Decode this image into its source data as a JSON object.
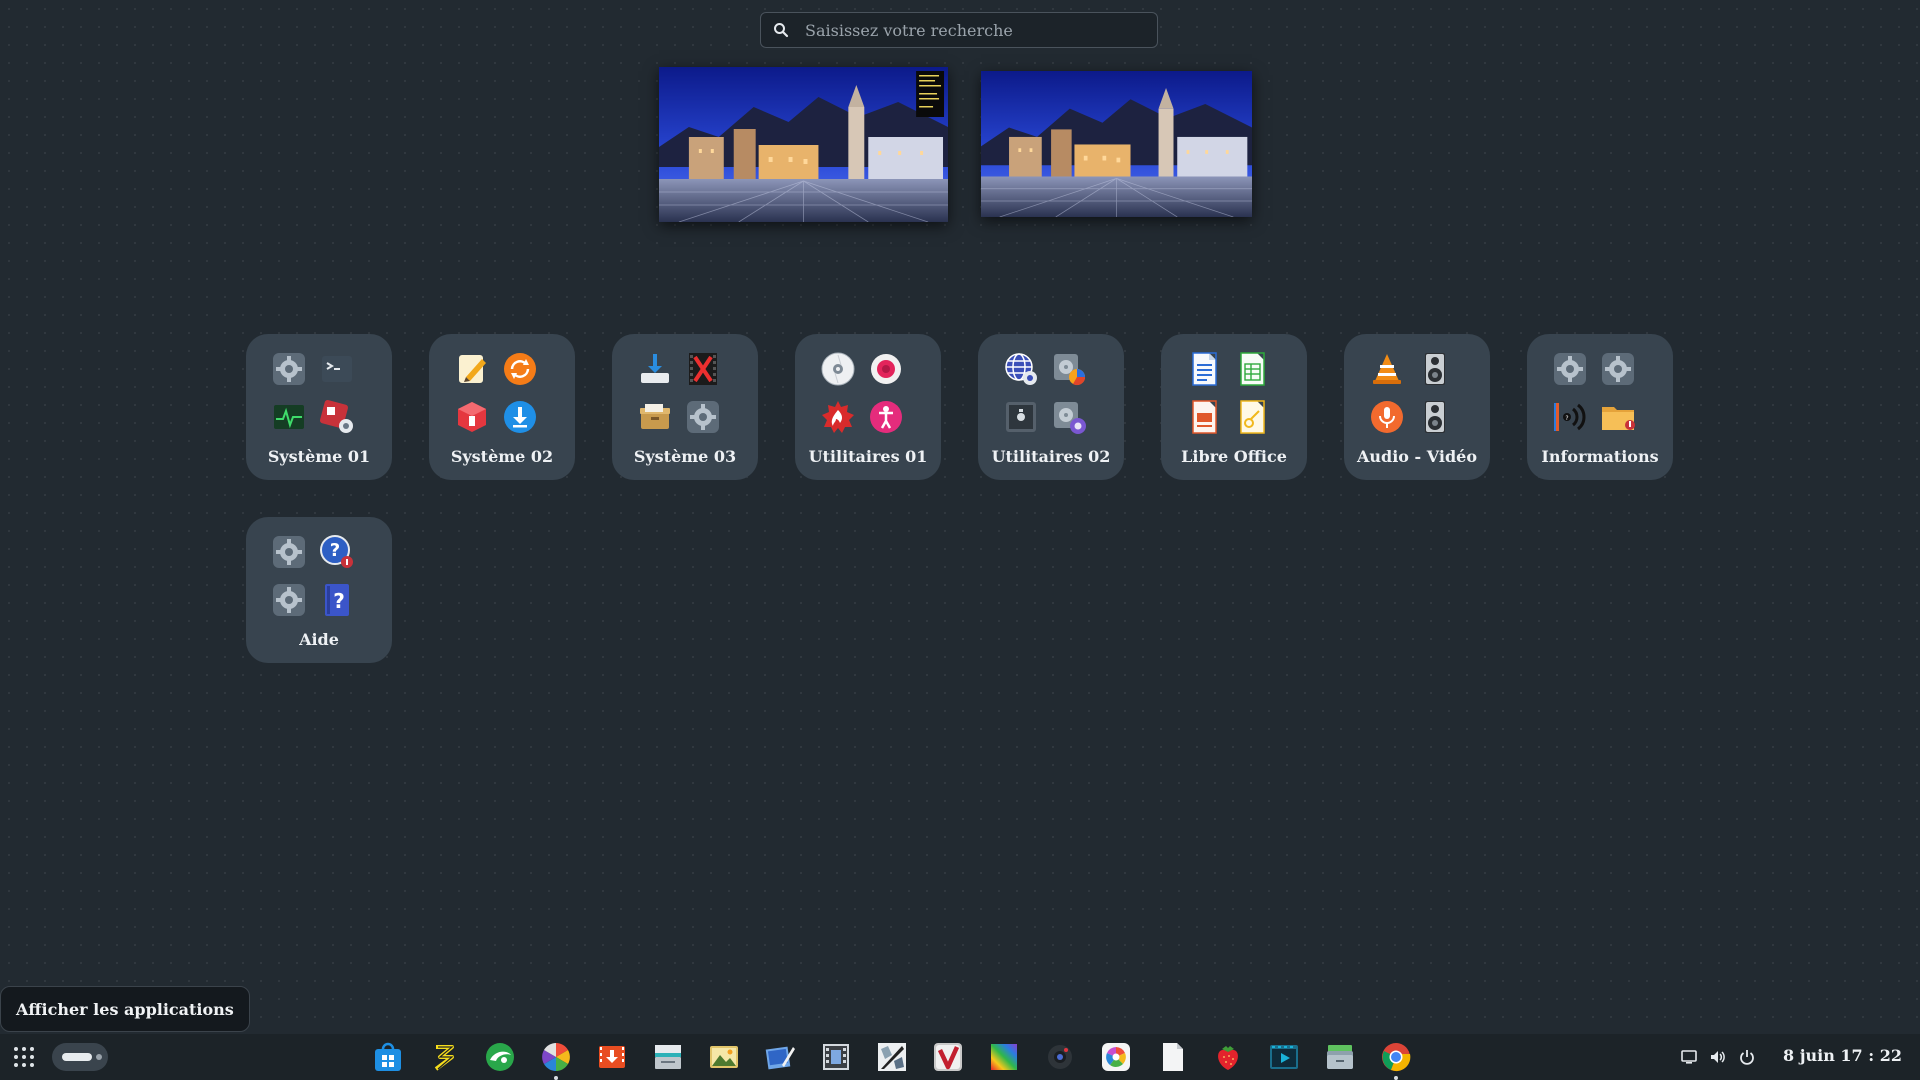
{
  "search": {
    "placeholder": "Saisissez votre recherche",
    "icon": "search-icon"
  },
  "workspaces": [
    {
      "name": "workspace-1",
      "thumbnail": "night town square with bell tower and mountains"
    },
    {
      "name": "workspace-2",
      "thumbnail": "night town square with bell tower and mountains"
    }
  ],
  "folders": [
    {
      "label": "Système 01",
      "icons": [
        "settings-gear-icon",
        "terminal-icon",
        "system-monitor-icon",
        "software-properties-icon"
      ]
    },
    {
      "label": "Système 02",
      "icons": [
        "text-editor-icon",
        "update-manager-icon",
        "package-installer-icon",
        "download-manager-icon"
      ]
    },
    {
      "label": "Système 03",
      "icons": [
        "install-icon",
        "file-close-icon",
        "archive-box-icon",
        "settings-gear-icon"
      ]
    },
    {
      "label": "Utilitaires 01",
      "icons": [
        "disc-burner-icon",
        "screen-recorder-icon",
        "firewall-icon",
        "accessibility-icon"
      ]
    },
    {
      "label": "Utilitaires 02",
      "icons": [
        "network-settings-icon",
        "disk-usage-icon",
        "screenshot-icon",
        "disk-settings-icon"
      ]
    },
    {
      "label": "Libre Office",
      "icons": [
        "writer-document-icon",
        "calc-spreadsheet-icon",
        "impress-presentation-icon",
        "draw-icon"
      ]
    },
    {
      "label": "Audio - Vidéo",
      "icons": [
        "vlc-icon",
        "speaker-icon",
        "sound-recorder-icon",
        "speaker-icon"
      ]
    },
    {
      "label": "Informations",
      "icons": [
        "settings-gear-icon",
        "settings-gear-icon",
        "audio-info-icon",
        "folder-icon"
      ]
    },
    {
      "label": "Aide",
      "icons": [
        "settings-gear-icon",
        "help-browser-icon",
        "settings-gear-icon",
        "help-book-icon"
      ]
    }
  ],
  "tooltip": {
    "text": "Afficher les applications"
  },
  "taskbar": {
    "apps_button_icon": "app-grid-icon",
    "dock": [
      {
        "name": "software-store-icon",
        "running": false
      },
      {
        "name": "synaptic-icon",
        "running": false
      },
      {
        "name": "browser-green-icon",
        "running": false
      },
      {
        "name": "shotwell-icon",
        "running": true
      },
      {
        "name": "video-downloader-icon",
        "running": false
      },
      {
        "name": "scanner-icon",
        "running": false
      },
      {
        "name": "image-viewer-icon",
        "running": false
      },
      {
        "name": "photo-editor-icon",
        "running": false
      },
      {
        "name": "video-editor-icon",
        "running": false
      },
      {
        "name": "inkscape-icon",
        "running": false
      },
      {
        "name": "vivaldi-icon",
        "running": false
      },
      {
        "name": "color-picker-icon",
        "running": false
      },
      {
        "name": "webcam-icon",
        "running": false
      },
      {
        "name": "color-wheel-icon",
        "running": false
      },
      {
        "name": "text-file-icon",
        "running": false
      },
      {
        "name": "strawberry-icon",
        "running": false
      },
      {
        "name": "media-player-icon",
        "running": false
      },
      {
        "name": "file-manager-icon",
        "running": false
      },
      {
        "name": "chrome-icon",
        "running": true
      }
    ],
    "tray": [
      "screen-icon",
      "volume-icon",
      "power-icon"
    ],
    "clock": "8 juin  17 : 22"
  }
}
